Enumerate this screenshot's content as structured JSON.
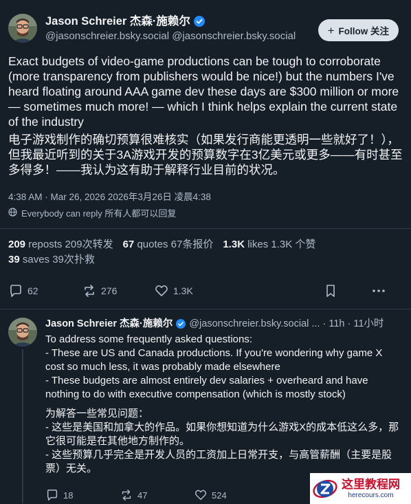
{
  "main_post": {
    "author_name": "Jason Schreier 杰森·施赖尔",
    "handle": "@jasonschreier.bsky.social @jasonschreier.bsky.social",
    "follow_label": "Follow 关注",
    "text_en": "Exact budgets of video-game productions can be tough to corroborate (more transparency from publishers would be nice!) but the numbers I've heard floating around AAA game dev these days are $300 million or more — sometimes much more! — which I think helps explain the current state of the industry",
    "text_cn": "电子游戏制作的确切预算很难核实（如果发行商能更透明一些就好了！），但我最近听到的关于3A游戏开发的预算数字在3亿美元或更多——有时甚至多得多！——我认为这有助于解释行业目前的状况。",
    "timestamp": "4:38 AM · Mar 26, 2026 2026年3月26日 凌晨4:38",
    "reply_setting": "Everybody can reply 所有人都可以回复",
    "stats": {
      "reposts_count": "209",
      "reposts_label": "reposts 209次转发",
      "quotes_count": "67",
      "quotes_label": "quotes 67条报价",
      "likes_count": "1.3K",
      "likes_label": "likes 1.3K 个赞",
      "saves_count": "39",
      "saves_label": "saves 39次扑救"
    },
    "actions": {
      "replies": "62",
      "reposts": "276",
      "likes": "1.3K"
    }
  },
  "reply_post": {
    "author_name": "Jason Schreier 杰森·施赖尔",
    "handle_time": "@jasonschreier.bsky.social ... · 11h · 11小时",
    "text_en": "To address some frequently asked questions:\n- These are US and Canada productions. If you're wondering why game X cost so much less, it was probably made elsewhere\n- These budgets are almost entirely dev salaries + overheard and have nothing to do with executive compensation (which is mostly stock)",
    "text_cn": "为解答一些常见问题：\n- 这些是美国和加拿大的作品。如果你想知道为什么游戏X的成本低这么多，那它很可能是在其他地方制作的。\n- 这些预算几乎完全是开发人员的工资加上日常开支，与高管薪酬（主要是股票）无关。",
    "actions": {
      "replies": "18",
      "reposts": "47",
      "likes": "524"
    }
  },
  "watermark": {
    "title": "这里教程网",
    "url": "herecours.com"
  },
  "colors": {
    "background": "#161e27",
    "text": "#f1f3f5",
    "muted": "#aebbc9",
    "verified": "#208bfe",
    "divider": "#2e3a47"
  }
}
